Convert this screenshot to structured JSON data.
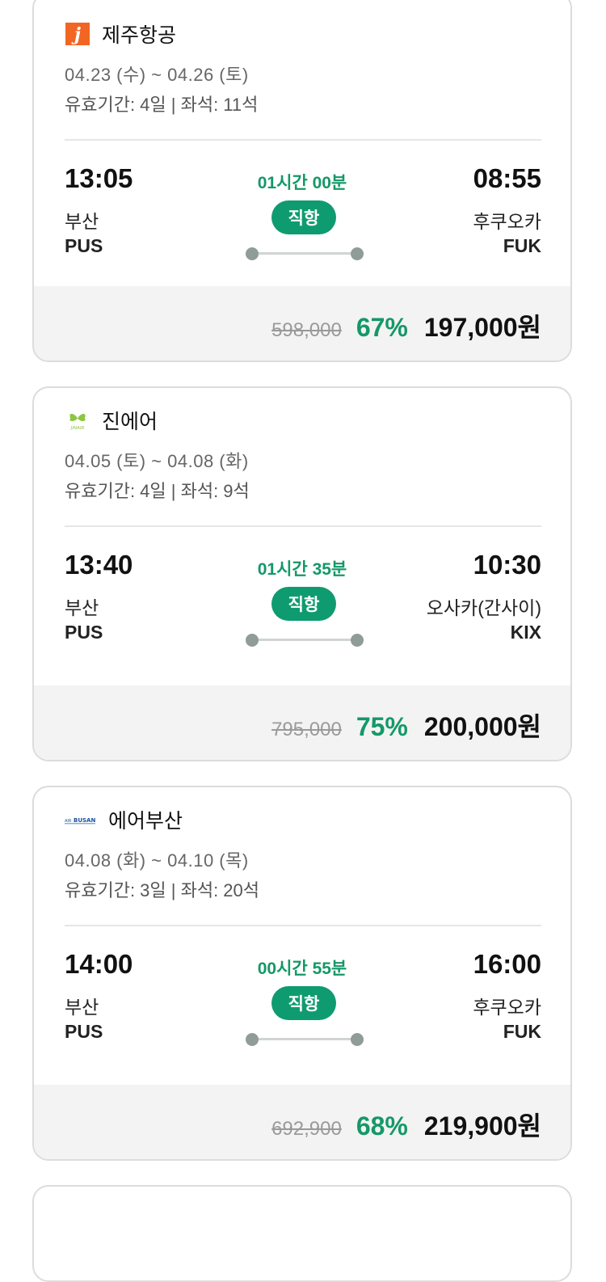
{
  "flights": [
    {
      "airline": "제주항공",
      "logo": "jejuair-logo",
      "dates": "04.23 (수) ~ 04.26 (토)",
      "meta": "유효기간: 4일 | 좌석: 11석",
      "dep_time": "13:05",
      "dep_city": "부산",
      "dep_code": "PUS",
      "duration": "01시간 00분",
      "direct": "직항",
      "arr_time": "08:55",
      "arr_city": "후쿠오카",
      "arr_code": "FUK",
      "orig_price": "598,000",
      "discount": "67%",
      "final_price": "197,000원"
    },
    {
      "airline": "진에어",
      "logo": "jinair-logo",
      "dates": "04.05 (토) ~ 04.08 (화)",
      "meta": "유효기간: 4일 | 좌석: 9석",
      "dep_time": "13:40",
      "dep_city": "부산",
      "dep_code": "PUS",
      "duration": "01시간 35분",
      "direct": "직항",
      "arr_time": "10:30",
      "arr_city": "오사카(간사이)",
      "arr_code": "KIX",
      "orig_price": "795,000",
      "discount": "75%",
      "final_price": "200,000원"
    },
    {
      "airline": "에어부산",
      "logo": "airbusan-logo",
      "dates": "04.08 (화) ~ 04.10 (목)",
      "meta": "유효기간: 3일 | 좌석: 20석",
      "dep_time": "14:00",
      "dep_city": "부산",
      "dep_code": "PUS",
      "duration": "00시간 55분",
      "direct": "직항",
      "arr_time": "16:00",
      "arr_city": "후쿠오카",
      "arr_code": "FUK",
      "orig_price": "692,900",
      "discount": "68%",
      "final_price": "219,900원"
    }
  ],
  "colors": {
    "accent_green": "#149869",
    "badge_green": "#0f9b70",
    "jeju_orange": "#f26522",
    "jinair_green": "#8dc63f",
    "airbusan_blue": "#1c4f9c"
  }
}
